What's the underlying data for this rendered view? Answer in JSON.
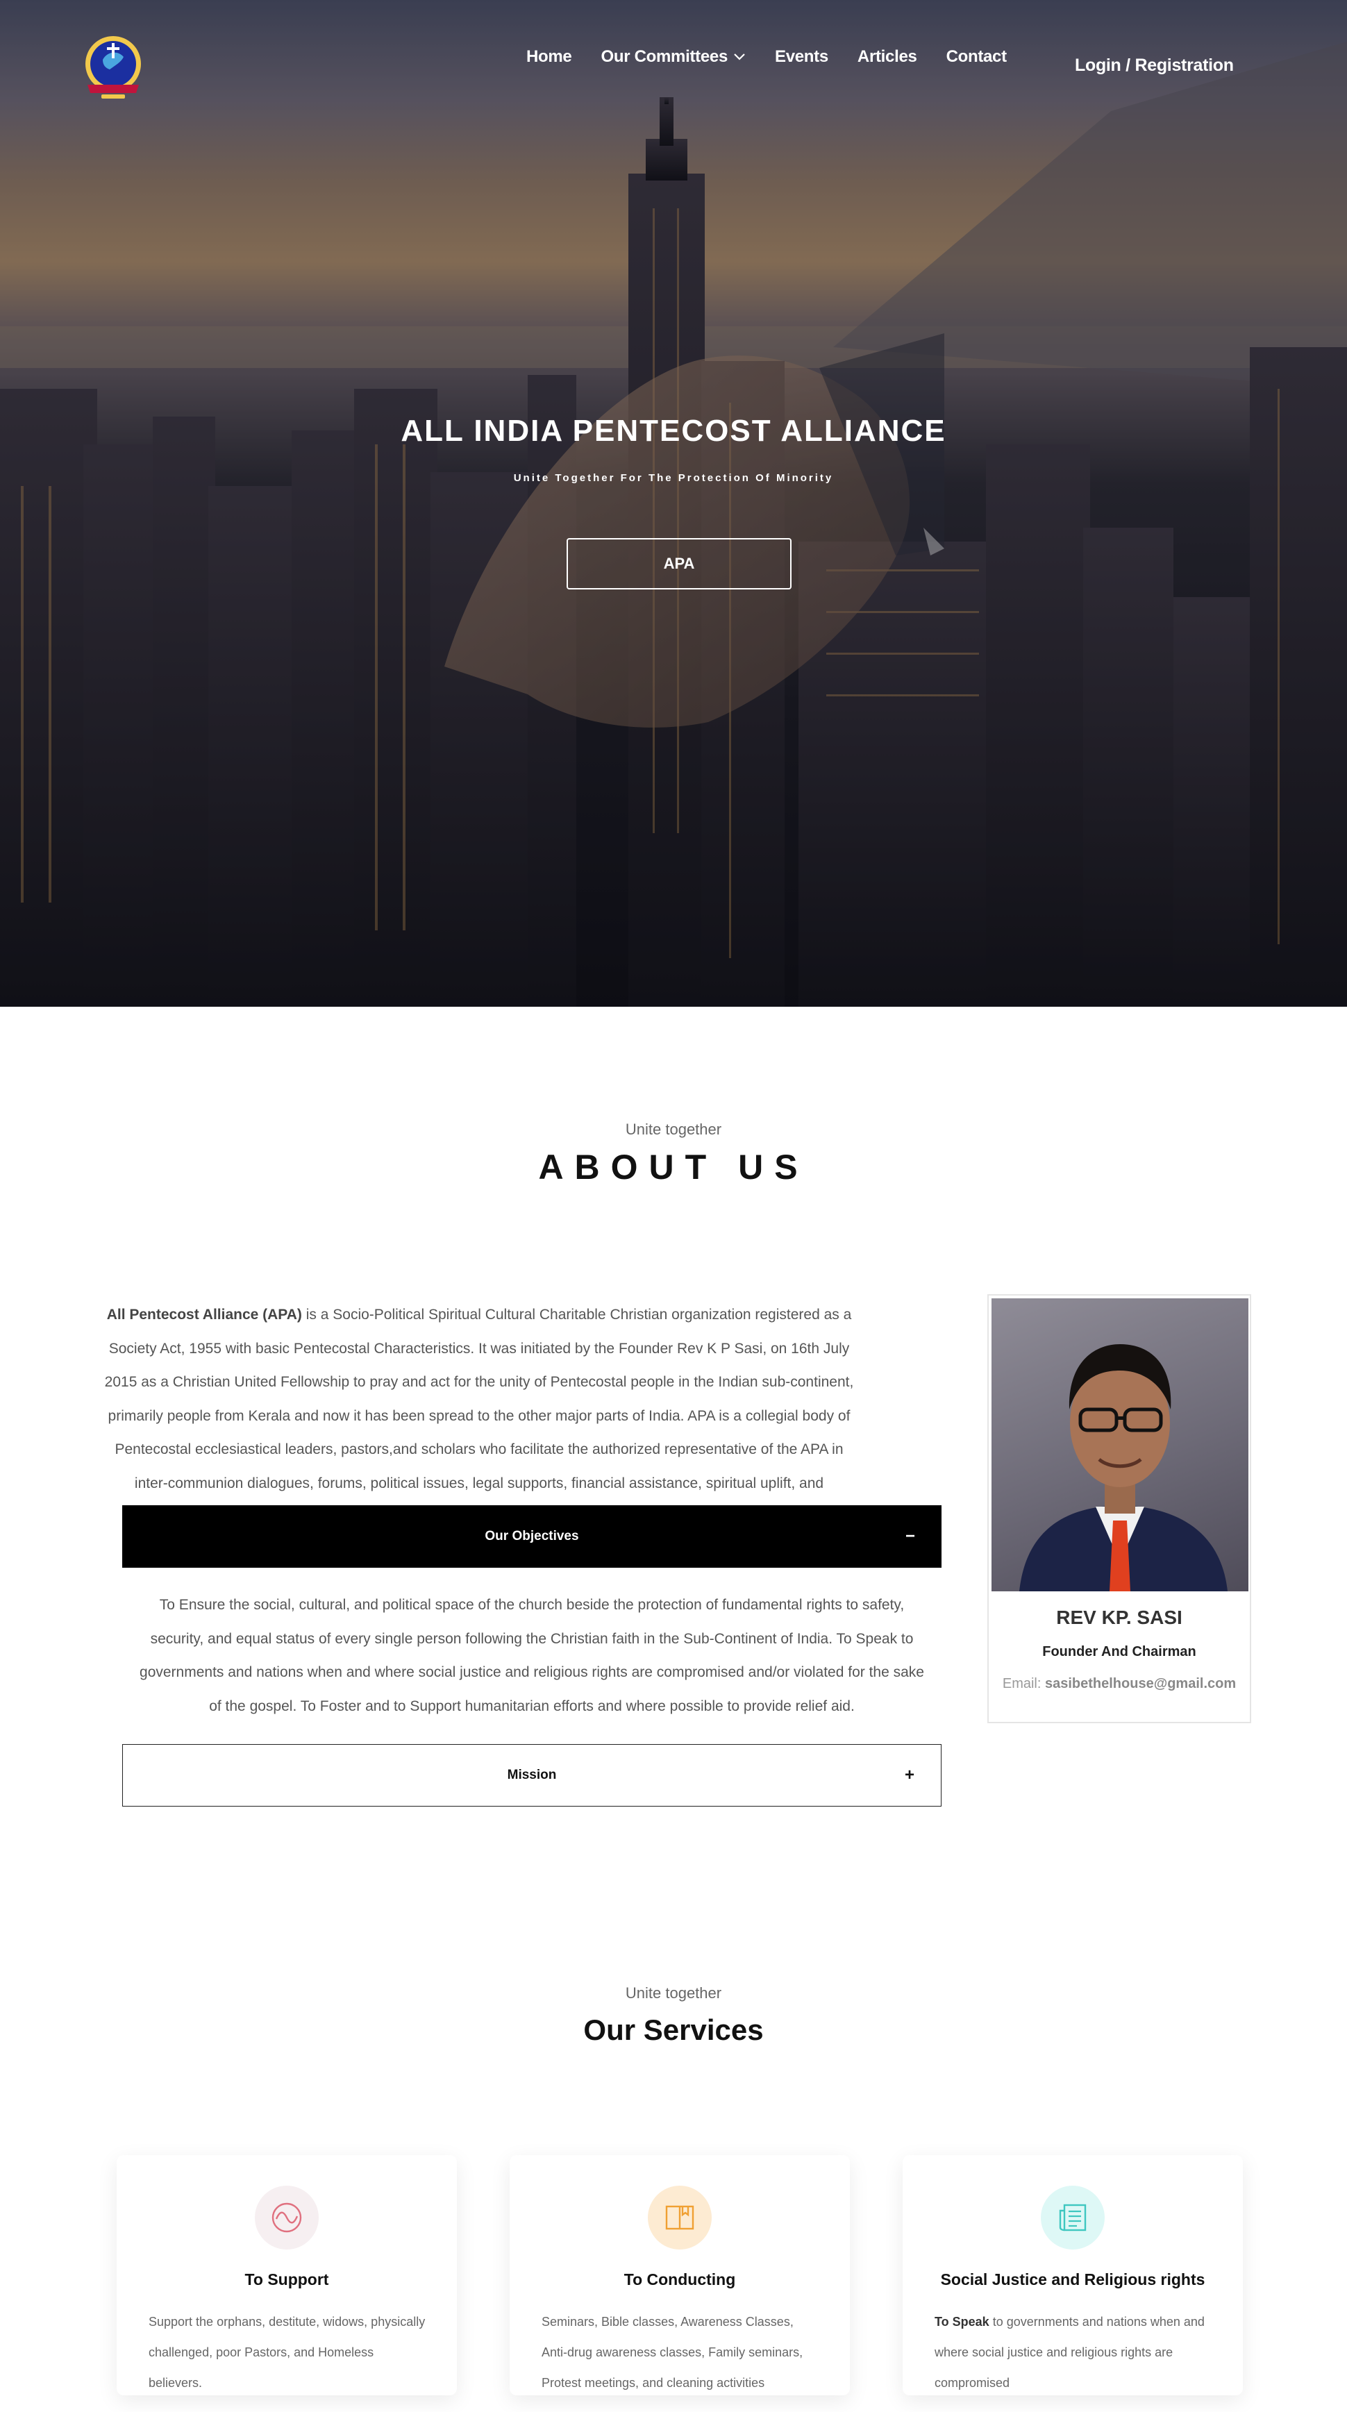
{
  "nav": {
    "items": [
      {
        "label": "Home"
      },
      {
        "label": "Our Committees",
        "has_dropdown": true
      },
      {
        "label": "Events"
      },
      {
        "label": "Articles"
      },
      {
        "label": "Contact"
      }
    ],
    "login_label": "Login / Registration"
  },
  "hero": {
    "title": "ALL INDIA PENTECOST ALLIANCE",
    "subtitle": "Unite Together For The Protection Of Minority",
    "button_label": "APA"
  },
  "about": {
    "kicker": "Unite together",
    "title": "ABOUT US",
    "lead_bold": "All Pentecost Alliance (APA)",
    "body": " is a Socio-Political Spiritual Cultural Charitable Christian organization registered as a Society Act, 1955 with basic Pentecostal Characteristics. It was initiated by the Founder Rev K P Sasi, on 16th July 2015 as a Christian United Fellowship to pray and act for the unity of Pentecostal people in the Indian sub-continent, primarily people from Kerala and now it has been spread to the other major parts of India. APA is a collegial body of Pentecostal ecclesiastical leaders, pastors,and scholars who facilitate the authorized representative of the APA in inter-communion dialogues, forums, political issues, legal supports, financial assistance, spiritual uplift, and supporting the persecuted churches without losing the harmony of our Independent.",
    "accordion": [
      {
        "title": "Our Objectives",
        "sign": "−",
        "expanded": true,
        "content": "To Ensure the social, cultural, and political space of the church beside the protection of fundamental rights to safety, security, and equal status of every single person following the Christian faith in the Sub-Continent of India. To Speak to governments and nations when and where social justice and religious rights are compromised and/or violated for the sake of the gospel. To Foster and to Support humanitarian efforts and where possible to provide relief aid."
      },
      {
        "title": "Mission",
        "sign": "+",
        "expanded": false
      }
    ],
    "profile": {
      "name": "REV KP. SASI",
      "role": "Founder And Chairman",
      "email_label": "Email: ",
      "email": "sasibethelhouse@gmail.com"
    }
  },
  "services": {
    "kicker": "Unite together",
    "title": "Our Services",
    "items": [
      {
        "icon": "wave-icon",
        "title": "To Support",
        "lead_bold": "",
        "desc": "Support the orphans, destitute, widows, physically challenged, poor Pastors, and Homeless believers."
      },
      {
        "icon": "book-icon",
        "title": "To Conducting",
        "lead_bold": "",
        "desc": "Seminars, Bible classes, Awareness Classes, Anti-drug awareness classes, Family seminars, Protest meetings, and cleaning activities"
      },
      {
        "icon": "newspaper-icon",
        "title": "Social Justice and Religious rights",
        "lead_bold": "To Speak",
        "desc": " to governments and nations when and where social justice and religious rights are compromised"
      }
    ]
  },
  "colors": {
    "accent_dark": "#000000",
    "support_icon": "#e0707f",
    "conducting_icon": "#f0a033",
    "justice_icon": "#3fc7c0"
  }
}
